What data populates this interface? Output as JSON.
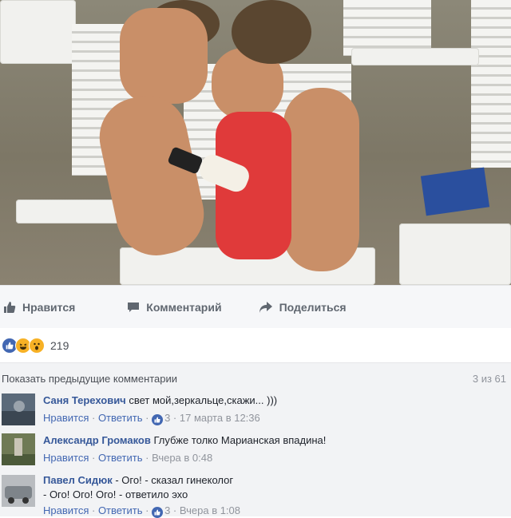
{
  "actions": {
    "like": "Нравится",
    "comment": "Комментарий",
    "share": "Поделиться"
  },
  "reactions": {
    "count": "219",
    "types": [
      "like-icon",
      "haha-icon",
      "wow-icon"
    ]
  },
  "comments": {
    "show_previous": "Показать предыдущие комментарии",
    "count": "3 из 61",
    "items": [
      {
        "author": "Саня Терехович",
        "text": "свет мой,зеркальце,скажи... )))",
        "text2": "",
        "like_label": "Нравится",
        "reply_label": "Ответить",
        "reactions": "3",
        "timestamp": "17 марта в 12:36"
      },
      {
        "author": "Александр Громаков",
        "text": "Глубже толко Марианская впадина!",
        "text2": "",
        "like_label": "Нравится",
        "reply_label": "Ответить",
        "reactions": "",
        "timestamp": "Вчера в 0:48"
      },
      {
        "author": "Павел Сидюк",
        "text": "- Ого! - сказал гинеколог",
        "text2": "- Ого! Ого! Ого! - ответило эхо",
        "like_label": "Нравится",
        "reply_label": "Ответить",
        "reactions": "3",
        "timestamp": "Вчера в 1:08"
      }
    ]
  },
  "colors": {
    "link": "#365899",
    "accent": "#4267b2",
    "meta": "#90949c",
    "comments_bg": "#f2f3f5"
  }
}
